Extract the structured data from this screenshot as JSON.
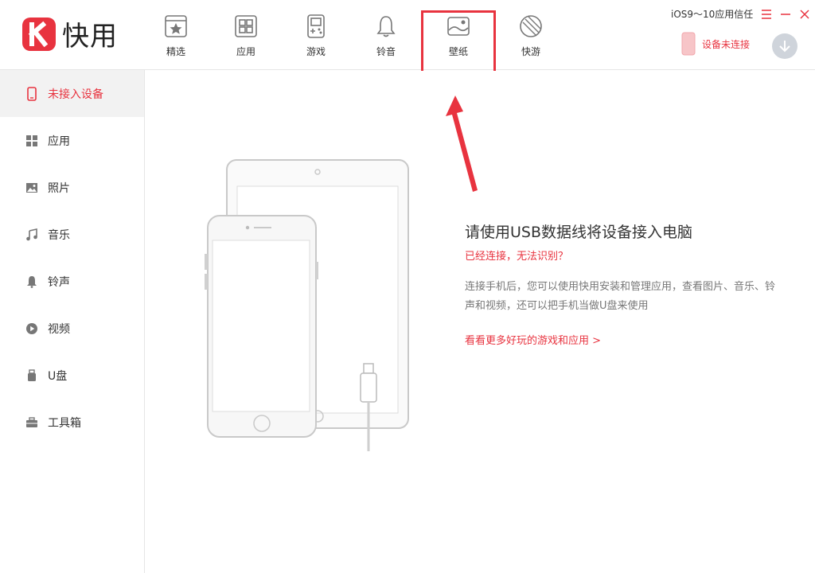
{
  "app": {
    "name": "快用",
    "brand_color": "#e8333f"
  },
  "nav": {
    "items": [
      {
        "label": "精选",
        "icon": "star-icon"
      },
      {
        "label": "应用",
        "icon": "apps-grid-icon"
      },
      {
        "label": "游戏",
        "icon": "gameboy-icon"
      },
      {
        "label": "铃音",
        "icon": "bell-icon"
      },
      {
        "label": "壁纸",
        "icon": "wallpaper-icon",
        "active": true
      },
      {
        "label": "快游",
        "icon": "leaf-icon"
      }
    ]
  },
  "titlebar": {
    "trust_text": "iOS9～10应用信任",
    "menu_icon": "hamburger-icon",
    "minimize_icon": "minimize-icon",
    "close_icon": "close-icon"
  },
  "device": {
    "status": "设备未连接"
  },
  "sidebar": {
    "items": [
      {
        "label": "未接入设备",
        "icon": "phone-icon",
        "active": true
      },
      {
        "label": "应用",
        "icon": "apps-grid-icon"
      },
      {
        "label": "照片",
        "icon": "photo-icon"
      },
      {
        "label": "音乐",
        "icon": "music-note-icon"
      },
      {
        "label": "铃声",
        "icon": "bell-icon"
      },
      {
        "label": "视频",
        "icon": "play-icon"
      },
      {
        "label": "U盘",
        "icon": "usb-drive-icon"
      },
      {
        "label": "工具箱",
        "icon": "toolbox-icon"
      }
    ]
  },
  "main": {
    "headline": "请使用USB数据线将设备接入电脑",
    "warning_link": "已经连接，无法识别？",
    "description": "连接手机后，您可以使用快用安装和管理应用，查看图片、音乐、铃声和视频，还可以把手机当做U盘来使用",
    "more_link": "看看更多好玩的游戏和应用 >"
  }
}
